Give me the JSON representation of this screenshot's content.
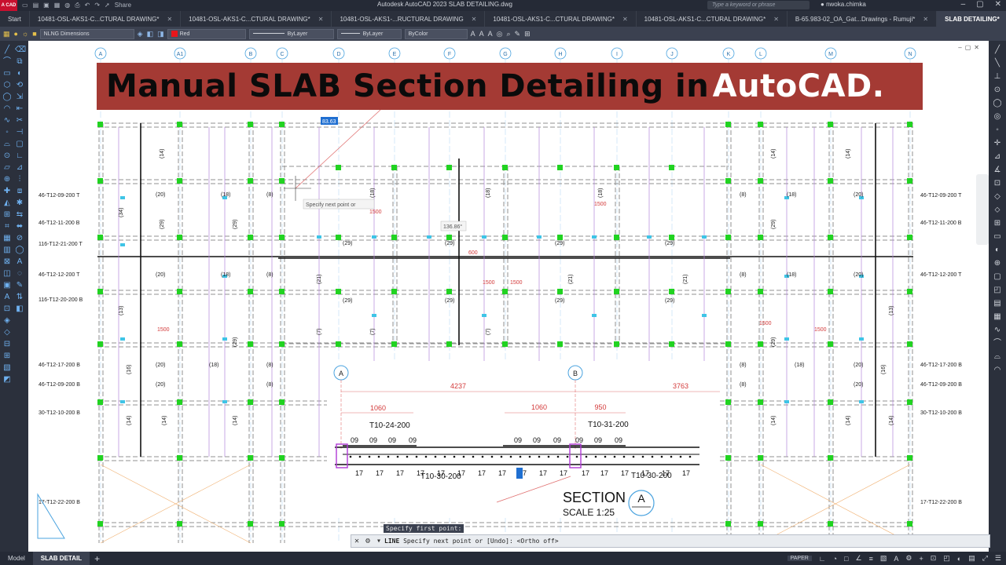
{
  "window": {
    "app_title": "Autodesk AutoCAD 2023   SLAB DETAILING.dwg",
    "logo_text": "A CAD",
    "share_label": "Share",
    "search_placeholder": "Type a keyword or phrase",
    "user_name": "nwoka.chimka"
  },
  "tabs": [
    {
      "label": "Start",
      "active": false
    },
    {
      "label": "10481-OSL-AKS1-C...CTURAL DRAWING*",
      "active": false
    },
    {
      "label": "10481-OSL-AKS1-C...CTURAL DRAWING*",
      "active": false
    },
    {
      "label": "10481-OSL-AKS1-...RUCTURAL DRAWING",
      "active": false
    },
    {
      "label": "10481-OSL-AKS1-C...CTURAL DRAWING*",
      "active": false
    },
    {
      "label": "10481-OSL-AKS1-C...CTURAL DRAWING*",
      "active": false
    },
    {
      "label": "B-65.983-02_OA_Gat...Drawings - Rumuji*",
      "active": false
    },
    {
      "label": "SLAB DETAILING*",
      "active": true
    }
  ],
  "properties": {
    "layer": "NLNG Dimensions",
    "color": "Red",
    "color_hex": "#e8161b",
    "linetype1": "ByLayer",
    "linetype2": "ByLayer",
    "plotstyle": "ByColor"
  },
  "banner": {
    "part1": "Manual SLAB Section Detailing in ",
    "part2": "AutoCAD."
  },
  "drawing": {
    "grid_labels": [
      "A",
      "A1",
      "B",
      "C",
      "D",
      "E",
      "F",
      "G",
      "H",
      "I",
      "J",
      "K",
      "L",
      "M",
      "N"
    ],
    "rebar_left": [
      "46-T12-09-200  T",
      "46-T12-11-200  B",
      "116-T12-21-200  T",
      "46-T12-12-200  T",
      "116-T12-20-200  B",
      "46-T12-17-200  B",
      "46-T12-09-200  B",
      "30-T12-10-200  B",
      "17-T12-22-200  B"
    ],
    "rebar_right": [
      "46-T12-09-200  T",
      "46-T12-11-200  B",
      "46-T12-12-200  T",
      "46-T12-17-200  B",
      "46-T12-09-200  B",
      "30-T12-10-200  B",
      "17-T12-22-200  B"
    ],
    "slab_marks": [
      "(14)",
      "(20)",
      "(18)",
      "(8)",
      "(29)",
      "(13)",
      "(16)",
      "(21)",
      "(7)",
      "(34)"
    ],
    "tooltip_prompt": "Specify next point or",
    "dyn_length": "83.63",
    "dyn_angle": "136.86°",
    "section": {
      "grid_a": "A",
      "grid_b": "B",
      "dim_total_left": "4237",
      "dim_total_right": "3763",
      "dim_1060_a": "1060",
      "dim_1060_b": "1060",
      "dim_950": "950",
      "top_bar_left": "T10-24-200",
      "top_bar_right": "T10-31-200",
      "bottom_bar_left": "T10-30-200",
      "bottom_bar_right": "T10-30-200",
      "top_marks": "09",
      "bottom_marks": "17",
      "title": "SECTION",
      "tag": "A",
      "scale": "SCALE  1:25"
    },
    "dim_1500": "1500",
    "dim_600": "600"
  },
  "command": {
    "history": "Specify first point:",
    "command_name": "LINE",
    "prompt_text": "Specify next point or [Undo]:  <Ortho off>"
  },
  "status": {
    "model_tab": "Model",
    "layout_tab": "SLAB DETAIL",
    "paper_label": "PAPER"
  }
}
